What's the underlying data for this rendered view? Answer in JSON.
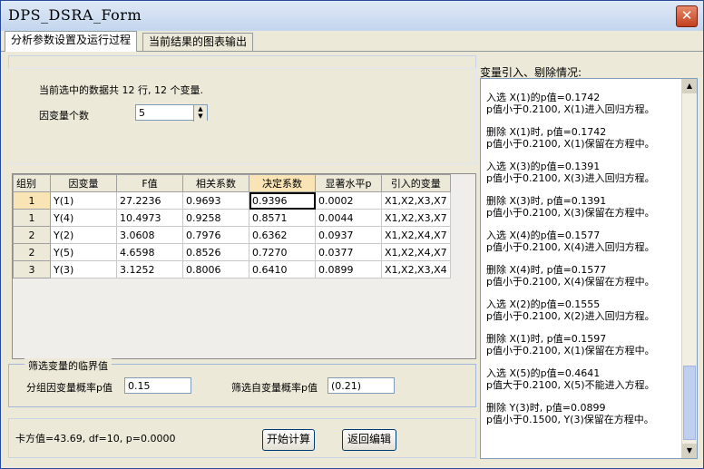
{
  "window": {
    "title": "DPS_DSRA_Form"
  },
  "tabs": [
    {
      "label": "分析参数设置及运行过程",
      "active": true
    },
    {
      "label": "当前结果的图表输出",
      "active": false
    }
  ],
  "info": {
    "summary": "当前选中的数据共 12 行, 12 个变量.",
    "dep_count_label": "因变量个数",
    "dep_count_value": "5"
  },
  "grid": {
    "headers": [
      "组别",
      "因变量",
      "F值",
      "相关系数",
      "决定系数",
      "显著水平p",
      "引入的变量"
    ],
    "rows": [
      [
        "1",
        "Y(1)",
        "27.2236",
        "0.9693",
        "0.9396",
        "0.0002",
        "X1,X2,X3,X7"
      ],
      [
        "1",
        "Y(4)",
        "10.4973",
        "0.9258",
        "0.8571",
        "0.0044",
        "X1,X2,X3,X7"
      ],
      [
        "2",
        "Y(2)",
        "3.0608",
        "0.7976",
        "0.6362",
        "0.0937",
        "X1,X2,X4,X7"
      ],
      [
        "2",
        "Y(5)",
        "4.6598",
        "0.8526",
        "0.7270",
        "0.0377",
        "X1,X2,X4,X7"
      ],
      [
        "3",
        "Y(3)",
        "3.1252",
        "0.8006",
        "0.6410",
        "0.0899",
        "X1,X2,X3,X4"
      ]
    ]
  },
  "threshold": {
    "group_title": "筛选变量的临界值",
    "dep_label": "分组因变量概率p值",
    "dep_value": "0.15",
    "indep_label": "筛选自变量概率p值",
    "indep_value": "0.21"
  },
  "status": {
    "chi_text": "卡方值=43.69, df=10,  p=0.0000"
  },
  "buttons": {
    "start": "开始计算",
    "back": "返回编辑"
  },
  "log": {
    "title": "变量引入、剔除情况:",
    "entries": [
      "入选 X(1)的p值=0.1742\np值小于0.2100, X(1)进入回归方程。",
      "删除 X(1)时, p值=0.1742\np值小于0.2100, X(1)保留在方程中。",
      "入选 X(3)的p值=0.1391\np值小于0.2100, X(3)进入回归方程。",
      "删除 X(3)时, p值=0.1391\np值小于0.2100, X(3)保留在方程中。",
      "入选 X(4)的p值=0.1577\np值小于0.2100, X(4)进入回归方程。",
      "删除 X(4)时, p值=0.1577\np值小于0.2100, X(4)保留在方程中。",
      "入选 X(2)的p值=0.1555\np值小于0.2100, X(2)进入回归方程。",
      "删除 X(1)时, p值=0.1597\np值小于0.2100, X(1)保留在方程中。",
      "入选 X(5)的p值=0.4641\np值大于0.2100, X(5)不能进入方程。",
      "删除 Y(3)时, p值=0.0899\np值小于0.1500, Y(3)保留在方程中。"
    ]
  }
}
